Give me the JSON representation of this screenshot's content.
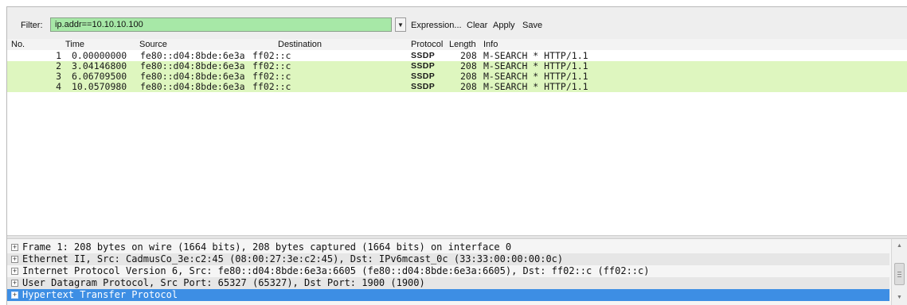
{
  "toolbar": {
    "filter_label": "Filter:",
    "filter_value": "ip.addr==10.10.10.100",
    "expression_label": "Expression...",
    "clear_label": "Clear",
    "apply_label": "Apply",
    "save_label": "Save",
    "filter_color": "#a7e8a7"
  },
  "packet_list": {
    "columns": {
      "no": "No.",
      "time": "Time",
      "source": "Source",
      "destination": "Destination",
      "protocol": "Protocol",
      "length": "Length",
      "info": "Info"
    },
    "rows": [
      {
        "no": "1",
        "time": "0.00000000",
        "source": "fe80::d04:8bde:6e3a",
        "destination": "ff02::c",
        "protocol": "SSDP",
        "length": "208",
        "info": "M-SEARCH * HTTP/1.1"
      },
      {
        "no": "2",
        "time": "3.04146800",
        "source": "fe80::d04:8bde:6e3a",
        "destination": "ff02::c",
        "protocol": "SSDP",
        "length": "208",
        "info": "M-SEARCH * HTTP/1.1"
      },
      {
        "no": "3",
        "time": "6.06709500",
        "source": "fe80::d04:8bde:6e3a",
        "destination": "ff02::c",
        "protocol": "SSDP",
        "length": "208",
        "info": "M-SEARCH * HTTP/1.1"
      },
      {
        "no": "4",
        "time": "10.0570980",
        "source": "fe80::d04:8bde:6e3a",
        "destination": "ff02::c",
        "protocol": "SSDP",
        "length": "208",
        "info": "M-SEARCH * HTTP/1.1"
      }
    ],
    "row_highlight_color": "#def6bf"
  },
  "details": {
    "items": [
      "Frame 1: 208 bytes on wire (1664 bits), 208 bytes captured (1664 bits) on interface 0",
      "Ethernet II, Src: CadmusCo_3e:c2:45 (08:00:27:3e:c2:45), Dst: IPv6mcast_0c (33:33:00:00:00:0c)",
      "Internet Protocol Version 6, Src: fe80::d04:8bde:6e3a:6605 (fe80::d04:8bde:6e3a:6605), Dst: ff02::c (ff02::c)",
      "User Datagram Protocol, Src Port: 65327 (65327), Dst Port: 1900 (1900)",
      "Hypertext Transfer Protocol"
    ],
    "expand_glyph": "+",
    "selected_color": "#3d8ee4"
  },
  "icons": {
    "dropdown": "dropdown-arrow-icon",
    "scroll_up": "scroll-up-icon",
    "scroll_down": "scroll-down-icon"
  }
}
